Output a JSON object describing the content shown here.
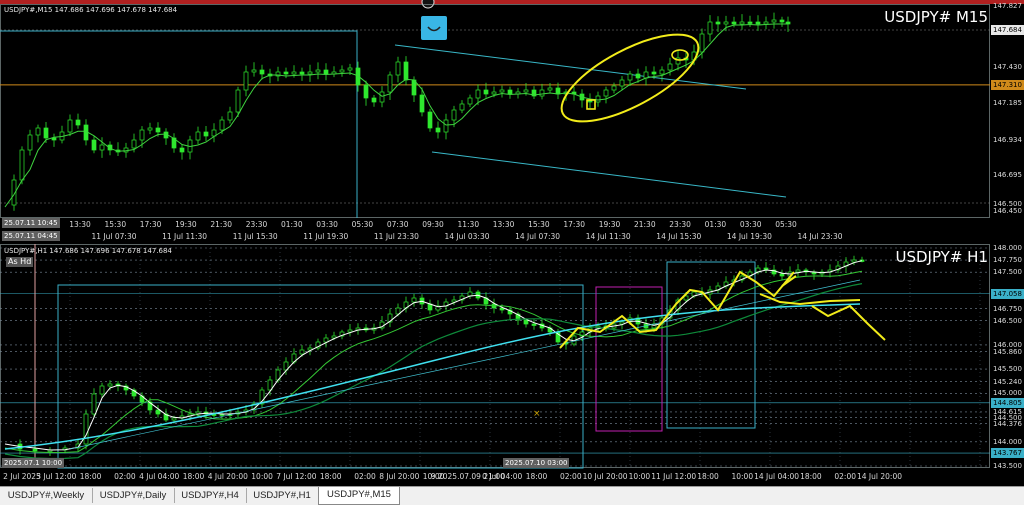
{
  "colors": {
    "background": "#000000",
    "grid": "#6a8aa0",
    "candle": "#2ee82e",
    "ma_fast": "#3fd33f",
    "channel": "#39b8c8",
    "marker_yellow": "#f2ec1a",
    "hline_orange": "#d08a1a",
    "cyan_box": "#3ab0c8",
    "magenta_box": "#c020b0",
    "tab_bar": "#f0f0f0"
  },
  "top_chart": {
    "header": "USDJPY#,M15  147.686 147.696 147.678 147.684",
    "symbol_label": "USDJPY# M15",
    "price_labels": [
      "147.827",
      "147.684",
      "147.430",
      "147.310",
      "147.185",
      "146.934",
      "146.695",
      "146.500",
      "146.450"
    ],
    "orange_level": "147.310",
    "time_labels": [
      "13:30",
      "15:30",
      "17:30",
      "19:30",
      "21:30",
      "23:30",
      "01:30",
      "03:30",
      "05:30",
      "07:30",
      "09:30",
      "11:30",
      "13:30",
      "15:30",
      "17:30",
      "19:30",
      "21:30",
      "23:30",
      "01:30",
      "03:30",
      "05:30"
    ],
    "date_labels": [
      "11 Jul 07:30",
      "11 Jul 11:30",
      "11 Jul 15:30",
      "11 Jul 19:30",
      "11 Jul 23:30",
      "14 Jul 03:30",
      "14 Jul 07:30",
      "14 Jul 11:30",
      "14 Jul 15:30",
      "14 Jul 19:30",
      "14 Jul 23:30"
    ],
    "cursor_time_top": "25.07.11 10:45",
    "cursor_time_bottom": "25.07.11 04:45",
    "alert_icon": "smile-icon"
  },
  "bottom_chart": {
    "header": "USDJPY#,H1  147.686 147.696 147.678 147.684",
    "symbol_label": "USDJPY# H1",
    "mode_badge": "As Hd",
    "price_labels": [
      "148.000",
      "147.750",
      "147.500",
      "147.058",
      "146.750",
      "146.500",
      "146.000",
      "145.860",
      "145.500",
      "145.240",
      "145.000",
      "144.805",
      "144.615",
      "144.500",
      "144.376",
      "144.000",
      "143.767",
      "143.500"
    ],
    "highlighted_prices": [
      "147.058",
      "144.805",
      "143.767"
    ],
    "time_labels": [
      "2 Jul 2025",
      "3 Jul 12:00",
      "18:00",
      "02:00",
      "4 Jul 04:00",
      "18:00",
      "4 Jul 20:00",
      "10:00",
      "7 Jul 12:00",
      "18:00",
      "02:00",
      "8 Jul 20:00",
      "10:00",
      "9 2025.07.09 21:00",
      "0 Jul 04:00",
      "18:00",
      "02:00",
      "10 Jul 20:00",
      "10:00",
      "11 Jul 12:00",
      "18:00",
      "10:00",
      "14 Jul 04:00",
      "18:00",
      "02:00",
      "14 Jul 20:00"
    ],
    "cursor_time": "2025.07.10 03:00",
    "cursor_label_left": "2025.07.1 10:00"
  },
  "tabs": [
    {
      "label": "USDJPY#,Weekly",
      "active": false
    },
    {
      "label": "USDJPY#,Daily",
      "active": false
    },
    {
      "label": "USDJPY#,H4",
      "active": false
    },
    {
      "label": "USDJPY#,H1",
      "active": false
    },
    {
      "label": "USDJPY#,M15",
      "active": true
    }
  ]
}
